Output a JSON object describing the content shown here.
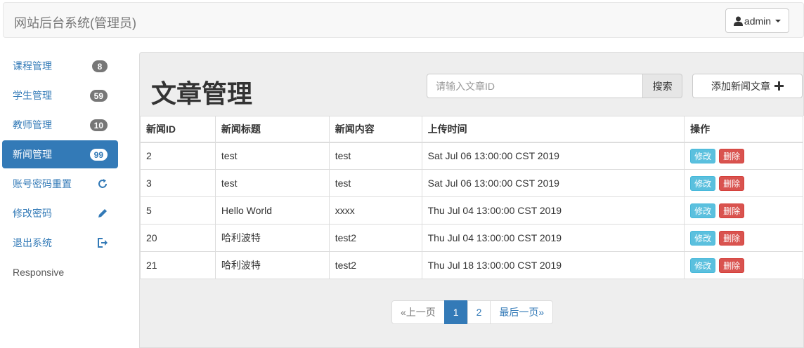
{
  "navbar": {
    "brand": "网站后台系统(管理员)",
    "user_label": "admin"
  },
  "sidebar": {
    "items": [
      {
        "label": "课程管理",
        "badge": "8"
      },
      {
        "label": "学生管理",
        "badge": "59"
      },
      {
        "label": "教师管理",
        "badge": "10"
      },
      {
        "label": "新闻管理",
        "badge": "99",
        "active": true
      },
      {
        "label": "账号密码重置",
        "icon": "refresh-icon"
      },
      {
        "label": "修改密码",
        "icon": "pencil-icon"
      },
      {
        "label": "退出系统",
        "icon": "logout-icon"
      }
    ],
    "footer_text": "Responsive"
  },
  "main": {
    "title": "文章管理",
    "search": {
      "placeholder": "请输入文章ID",
      "value": "",
      "button_label": "搜索"
    },
    "add_button_label": "添加新闻文章",
    "table": {
      "headers": [
        "新闻ID",
        "新闻标题",
        "新闻内容",
        "上传时间",
        "操作"
      ],
      "rows": [
        [
          "2",
          "test",
          "test",
          "Sat Jul 06 13:00:00 CST 2019"
        ],
        [
          "3",
          "test",
          "test",
          "Sat Jul 06 13:00:00 CST 2019"
        ],
        [
          "5",
          "Hello World",
          "xxxx",
          "Thu Jul 04 13:00:00 CST 2019"
        ],
        [
          "20",
          "哈利波特",
          "test2",
          "Thu Jul 04 13:00:00 CST 2019"
        ],
        [
          "21",
          "哈利波特",
          "test2",
          "Thu Jul 18 13:00:00 CST 2019"
        ]
      ],
      "edit_label": "修改",
      "delete_label": "删除"
    },
    "pagination": {
      "prev_label": "«上一页",
      "pages": [
        "1",
        "2"
      ],
      "current": "1",
      "last_label": "最后一页»"
    }
  },
  "colors": {
    "primary": "#337ab7",
    "info": "#5bc0de",
    "danger": "#d9534f",
    "badge": "#777777"
  }
}
